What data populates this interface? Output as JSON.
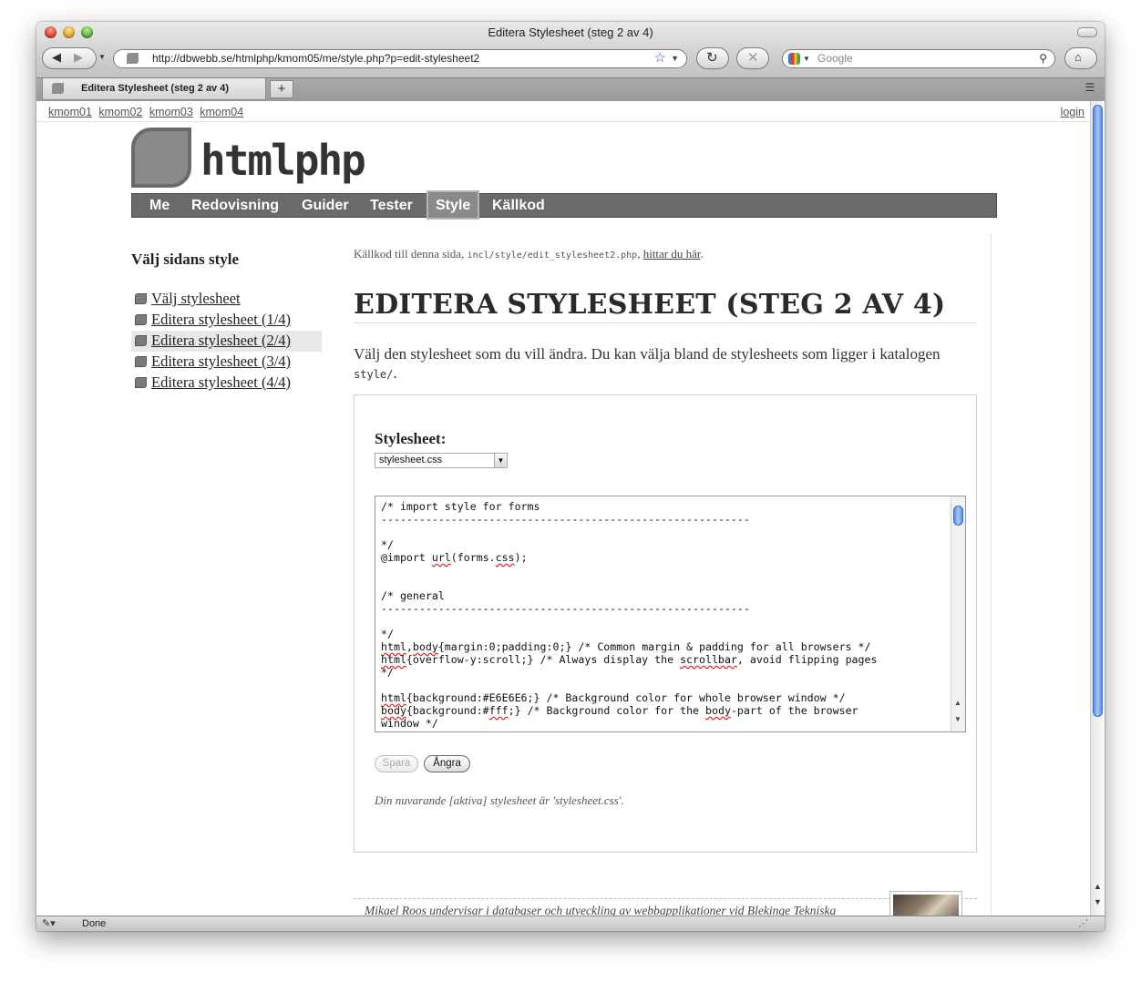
{
  "browser": {
    "window_title": "Editera Stylesheet (steg 2 av 4)",
    "url": "http://dbwebb.se/htmlphp/kmom05/me/style.php?p=edit-stylesheet2",
    "search_placeholder": "Google",
    "tab_label": "Editera Stylesheet (steg 2 av 4)",
    "new_tab": "+",
    "status": "Done"
  },
  "page": {
    "top_links": [
      "kmom01",
      "kmom02",
      "kmom03",
      "kmom04"
    ],
    "login": "login",
    "site_title": "htmlphp",
    "nav": {
      "items": [
        "Me",
        "Redovisning",
        "Guider",
        "Tester",
        "Style",
        "Källkod"
      ],
      "selected": "Style"
    },
    "sidebar": {
      "title": "Välj sidans style",
      "items": [
        {
          "label": "Välj stylesheet",
          "active": false
        },
        {
          "label": "Editera stylesheet (1/4)",
          "active": false
        },
        {
          "label": "Editera stylesheet (2/4)",
          "active": true
        },
        {
          "label": "Editera stylesheet (3/4)",
          "active": false
        },
        {
          "label": "Editera stylesheet (4/4)",
          "active": false
        }
      ]
    },
    "source_note": {
      "prefix": "Källkod till denna sida, ",
      "file": "incl/style/edit_stylesheet2.php",
      "sep": ", ",
      "link": "hittar du här",
      "suffix": "."
    },
    "heading": "EDITERA STYLESHEET (STEG 2 AV 4)",
    "intro": {
      "text": "Välj den stylesheet som du vill ändra. Du kan välja bland de stylesheets som ligger i katalogen",
      "dir": "style/",
      "end": "."
    },
    "form": {
      "label": "Stylesheet:",
      "selected_file": "stylesheet.css",
      "code_lines": [
        "/* import style for forms",
        "----------------------------------------------------------",
        "",
        "*/",
        "@import url(forms.css);",
        "",
        "",
        "/* general",
        "----------------------------------------------------------",
        "",
        "*/",
        "html,body{margin:0;padding:0;} /* Common margin & padding for all browsers */",
        "html{overflow-y:scroll;} /* Always display the scrollbar, avoid flipping pages",
        "*/",
        "",
        "html{background:#E6E6E6;} /* Background color for whole browser window */",
        "body{background:#fff;} /* Background color for the body-part of the browser",
        "window */"
      ],
      "save_button": "Spara",
      "undo_button": "Ångra",
      "current_text": "Din nuvarande [aktiva] stylesheet är 'stylesheet.css'."
    },
    "footer_text": "Mikael Roos undervisar i databaser och utveckling av webbapplikationer vid Blekinge Tekniska"
  }
}
